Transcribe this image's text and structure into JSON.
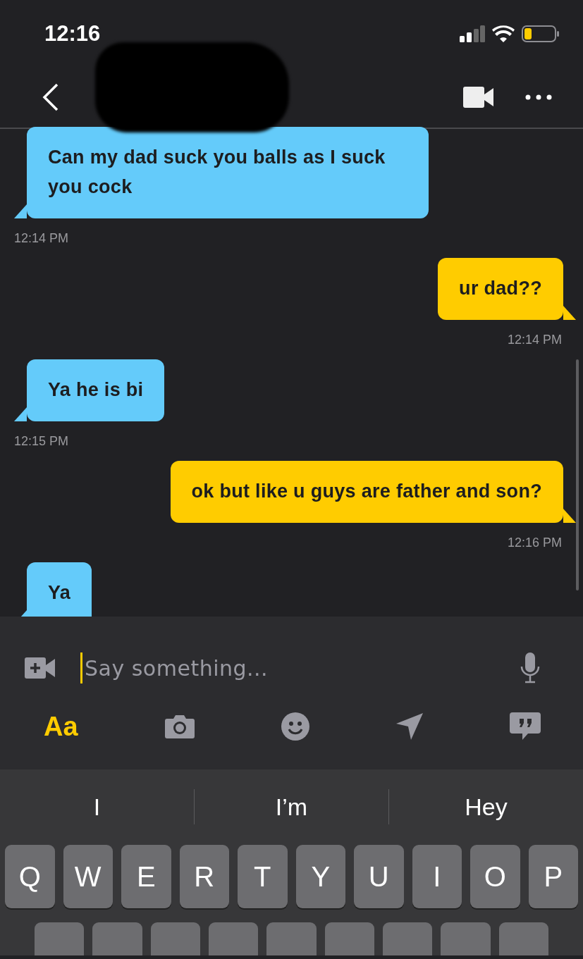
{
  "status_bar": {
    "time": "12:16"
  },
  "messages": [
    {
      "kind": "incoming",
      "text": "Can my dad suck you balls as I suck you cock",
      "time": "12:14 PM"
    },
    {
      "kind": "outgoing",
      "text": "ur dad??",
      "time": "12:14 PM"
    },
    {
      "kind": "incoming",
      "text": "Ya he is bi",
      "time": "12:15 PM"
    },
    {
      "kind": "outgoing",
      "text": "ok but like u guys are father and son?",
      "time": "12:16 PM"
    },
    {
      "kind": "incoming",
      "text": "Ya"
    }
  ],
  "composer": {
    "placeholder": "Say something..."
  },
  "toolbar": {
    "format_label": "Aa"
  },
  "keyboard": {
    "suggestions": [
      "I",
      "I’m",
      "Hey"
    ],
    "keys": [
      "Q",
      "W",
      "E",
      "R",
      "T",
      "Y",
      "U",
      "I",
      "O",
      "P"
    ]
  }
}
